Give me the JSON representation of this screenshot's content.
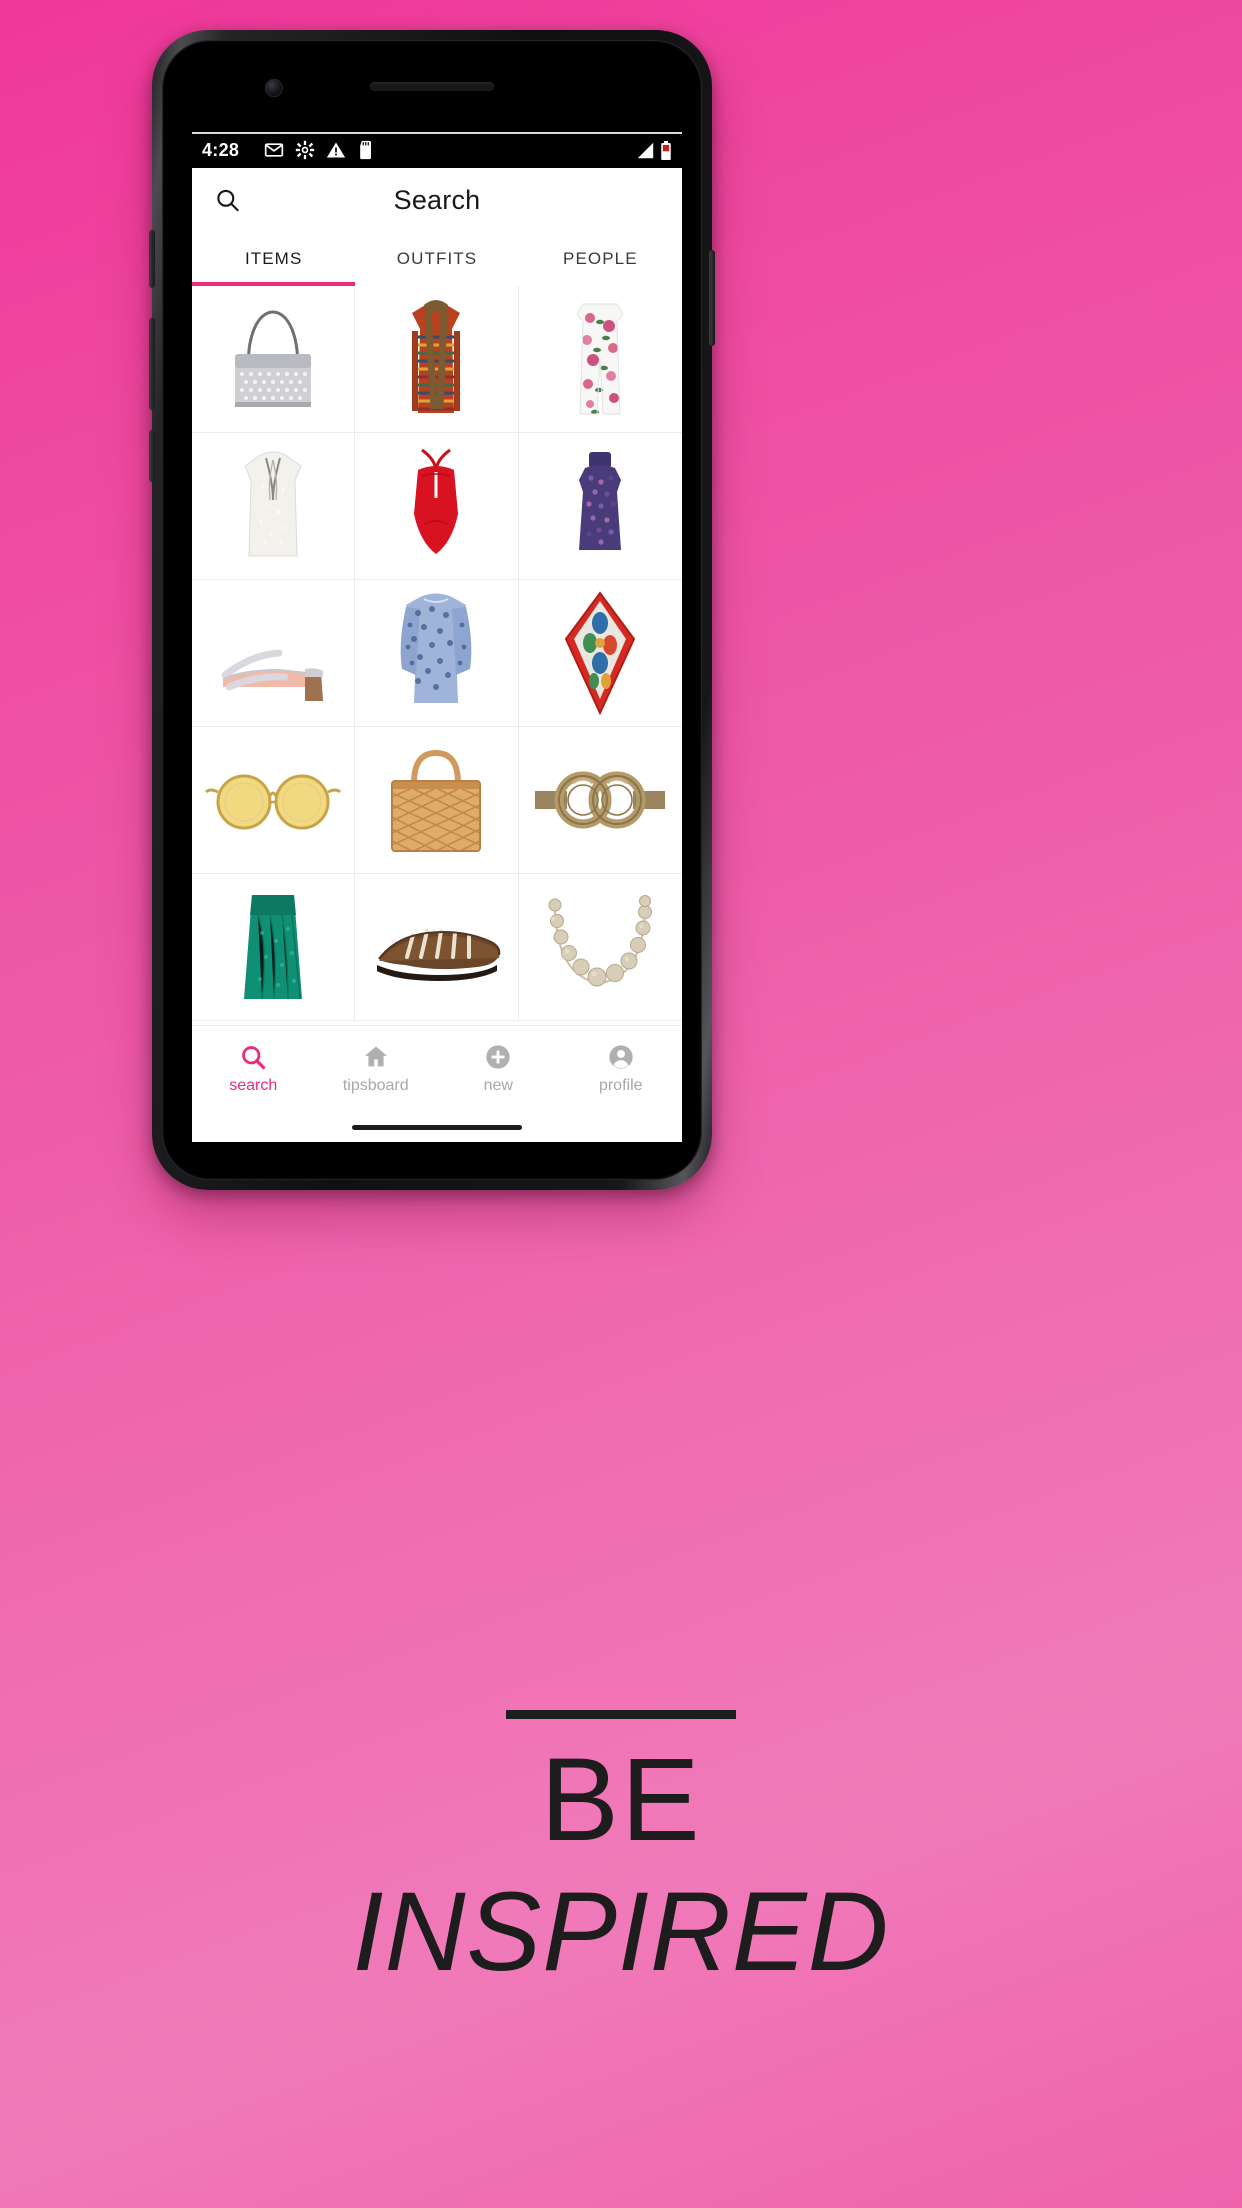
{
  "background": {
    "gradient_from": "#f0379a",
    "gradient_to": "#f07ab9"
  },
  "accent_color": "#ec2a7f",
  "phone": {
    "status_bar": {
      "time": "4:28",
      "left_icons": [
        "gmail-icon",
        "gear-icon",
        "warning-icon",
        "sdcard-icon"
      ],
      "right_icons": [
        "signal-icon",
        "battery-icon"
      ]
    },
    "app_bar": {
      "title": "Search",
      "leading_icon": "search-icon"
    },
    "tabs": [
      {
        "label": "ITEMS",
        "active": true
      },
      {
        "label": "OUTFITS",
        "active": false
      },
      {
        "label": "PEOPLE",
        "active": false
      }
    ],
    "grid": {
      "columns": 3,
      "items": [
        {
          "name": "silver chainmail shoulder bag",
          "kind": "bag-silver"
        },
        {
          "name": "striped fur-trim long coat",
          "kind": "coat-striped"
        },
        {
          "name": "white floral print jumpsuit",
          "kind": "jumpsuit-floral"
        },
        {
          "name": "white sequin sleeveless blouse",
          "kind": "blouse-white"
        },
        {
          "name": "red halter neck swimsuit",
          "kind": "swimsuit-red"
        },
        {
          "name": "purple sequin turtleneck top",
          "kind": "top-sequin"
        },
        {
          "name": "silver block heel mule sandal",
          "kind": "shoe-mule"
        },
        {
          "name": "blue lace bell sleeve dress",
          "kind": "dress-lace"
        },
        {
          "name": "red floral print silk scarf",
          "kind": "scarf-floral"
        },
        {
          "name": "round yellow tinted sunglasses",
          "kind": "sunglasses"
        },
        {
          "name": "woven straw tote bag",
          "kind": "bag-straw"
        },
        {
          "name": "gold double circle buckle belt",
          "kind": "belt-gold"
        },
        {
          "name": "green sequin wrap skirt",
          "kind": "skirt-green"
        },
        {
          "name": "brown woven leather flat sandal",
          "kind": "sandal-brown"
        },
        {
          "name": "beige beaded stone necklace",
          "kind": "necklace-beads"
        }
      ]
    },
    "bottom_nav": [
      {
        "label": "search",
        "icon": "search-icon",
        "active": true
      },
      {
        "label": "tipsboard",
        "icon": "home-icon",
        "active": false
      },
      {
        "label": "new",
        "icon": "plus-circle-icon",
        "active": false
      },
      {
        "label": "profile",
        "icon": "account-circle-icon",
        "active": false
      }
    ]
  },
  "caption": {
    "line1": "BE",
    "line2": "INSPIRED"
  }
}
